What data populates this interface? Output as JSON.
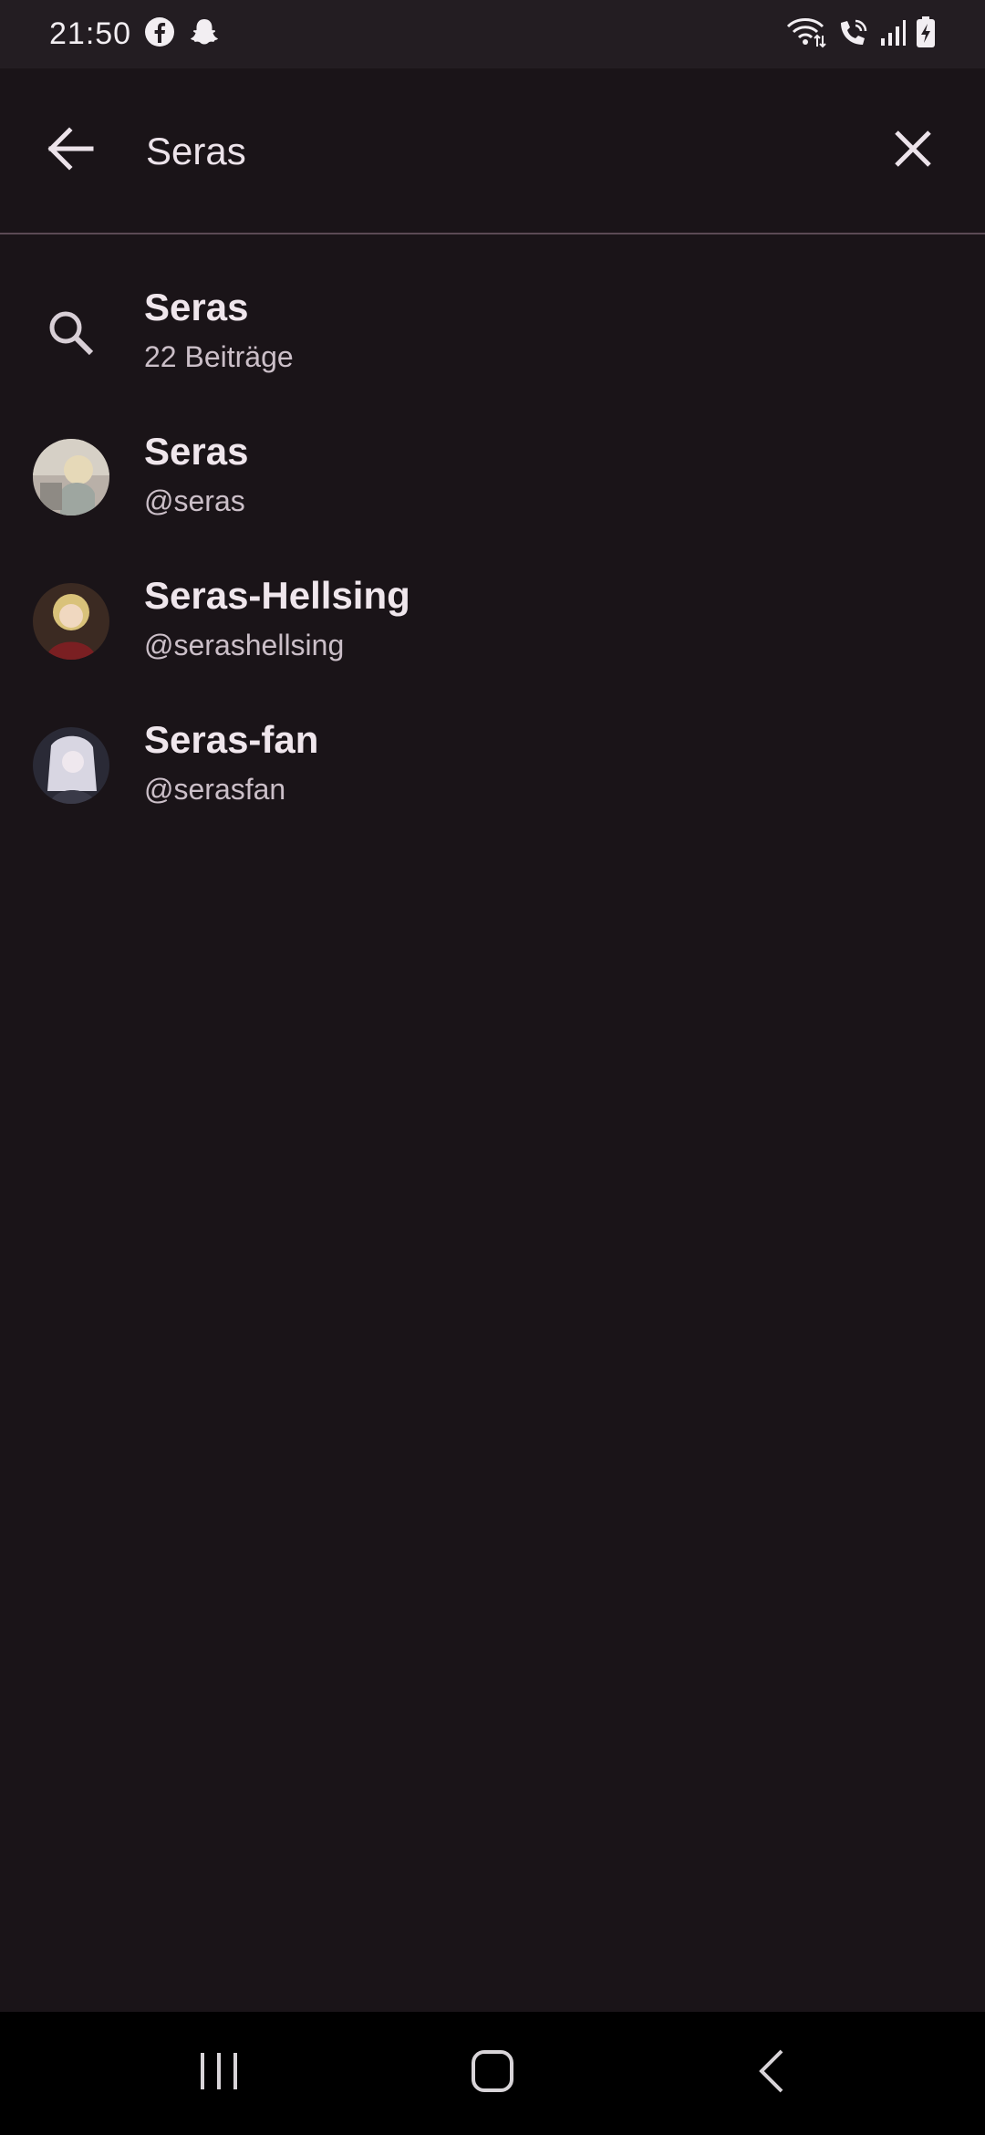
{
  "status": {
    "time": "21:50",
    "left_icons": [
      "facebook-icon",
      "snapchat-icon"
    ],
    "right_icons": [
      "wifi-icon",
      "wifi-call-icon",
      "signal-icon",
      "battery-charging-icon"
    ]
  },
  "search": {
    "query": "Seras",
    "back_icon": "arrow-left-icon",
    "clear_icon": "close-icon"
  },
  "results": [
    {
      "type": "query",
      "title": "Seras",
      "subtitle": "22 Beiträge",
      "icon": "search-icon"
    },
    {
      "type": "user",
      "title": "Seras",
      "subtitle": "@seras",
      "icon": "avatar"
    },
    {
      "type": "user",
      "title": "Seras-Hellsing",
      "subtitle": "@serashellsing",
      "icon": "avatar"
    },
    {
      "type": "user",
      "title": "Seras-fan",
      "subtitle": "@serasfan",
      "icon": "avatar"
    }
  ],
  "nav": {
    "recent_icon": "recent-apps-icon",
    "home_icon": "home-icon",
    "back_icon": "back-chevron-icon"
  },
  "colors": {
    "background": "#1a1418",
    "status_bar": "#231d22",
    "divider": "#5b4a55",
    "text_primary": "#efe6ec",
    "text_secondary": "#cbbfc8"
  }
}
